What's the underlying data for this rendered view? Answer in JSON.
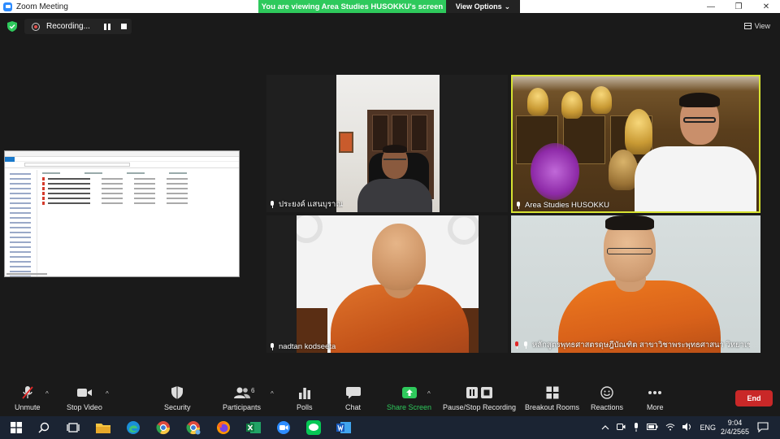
{
  "window": {
    "title": "Zoom Meeting",
    "minimize": "—",
    "restore": "❐",
    "close": "✕"
  },
  "banner": {
    "message": "You are viewing Area Studies HUSOKKU's screen",
    "view_options": "View Options",
    "view_options_caret": "⌄"
  },
  "recording": {
    "label": "Recording..."
  },
  "view_button": {
    "label": "View"
  },
  "participants": [
    {
      "name": "ประยงค์ แสนบุราณ"
    },
    {
      "name": "Area Studies HUSOKKU"
    },
    {
      "name": "nadtan kodseeta"
    },
    {
      "name": "หลักสูตรพุทธศาสตรดุษฎีบัณฑิต สาขาวิชาพระพุทธศาสนา วิทยาเขตข..."
    }
  ],
  "toolbar": {
    "unmute": "Unmute",
    "stop_video": "Stop Video",
    "security": "Security",
    "participants": "Participants",
    "participants_count": "6",
    "polls": "Polls",
    "chat": "Chat",
    "share_screen": "Share Screen",
    "pause_stop_recording": "Pause/Stop Recording",
    "breakout_rooms": "Breakout Rooms",
    "reactions": "Reactions",
    "more": "More",
    "end": "End",
    "caret": "^"
  },
  "taskbar": {
    "language": "ENG",
    "time": "9:04",
    "date": "2/4/2565"
  },
  "colors": {
    "accent_green": "#2ec95c",
    "active_speaker": "#d7e332",
    "end_red": "#c92828",
    "zoom_blue": "#2d8cff"
  }
}
